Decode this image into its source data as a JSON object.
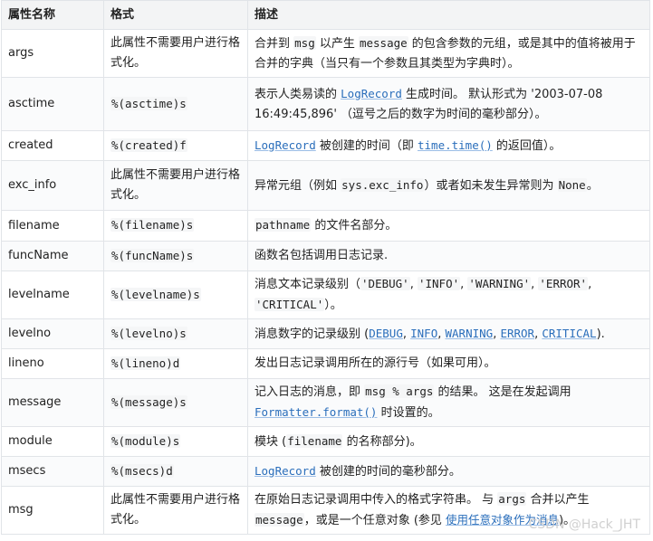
{
  "headers": [
    "属性名称",
    "格式",
    "描述"
  ],
  "rows": [
    {
      "name": "args",
      "format": "此属性不需要用户进行格式化。",
      "desc": [
        {
          "t": "合并到 "
        },
        {
          "c": "msg"
        },
        {
          "t": " 以产生 "
        },
        {
          "c": "message"
        },
        {
          "t": " 的包含参数的元组，或是其中的值将被用于合并的字典（当只有一个参数且其类型为字典时）。"
        }
      ]
    },
    {
      "name": "asctime",
      "format_code": "%(asctime)s",
      "desc": [
        {
          "t": "表示人类易读的 "
        },
        {
          "l": "LogRecord"
        },
        {
          "t": " 生成时间。 默认形式为 '2003-07-08 16:49:45,896' （逗号之后的数字为时间的毫秒部分）。"
        }
      ]
    },
    {
      "name": "created",
      "format_code": "%(created)f",
      "desc": [
        {
          "l": "LogRecord"
        },
        {
          "t": " 被创建的时间（即 "
        },
        {
          "l": "time.time()"
        },
        {
          "t": " 的返回值）。"
        }
      ]
    },
    {
      "name": "exc_info",
      "format": "此属性不需要用户进行格式化。",
      "desc": [
        {
          "t": "异常元组（例如 "
        },
        {
          "c": "sys.exc_info"
        },
        {
          "t": "）或者如未发生异常则为 "
        },
        {
          "c": "None"
        },
        {
          "t": "。"
        }
      ]
    },
    {
      "name": "filename",
      "format_code": "%(filename)s",
      "desc": [
        {
          "c": "pathname"
        },
        {
          "t": " 的文件名部分。"
        }
      ]
    },
    {
      "name": "funcName",
      "format_code": "%(funcName)s",
      "desc": [
        {
          "t": "函数名包括调用日志记录."
        }
      ]
    },
    {
      "name": "levelname",
      "format_code": "%(levelname)s",
      "desc": [
        {
          "t": "消息文本记录级别（"
        },
        {
          "c": "'DEBUG'"
        },
        {
          "t": ", "
        },
        {
          "c": "'INFO'"
        },
        {
          "t": ", "
        },
        {
          "c": "'WARNING'"
        },
        {
          "t": ", "
        },
        {
          "c": "'ERROR'"
        },
        {
          "t": ", "
        },
        {
          "c": "'CRITICAL'"
        },
        {
          "t": "）。"
        }
      ]
    },
    {
      "name": "levelno",
      "format_code": "%(levelno)s",
      "desc": [
        {
          "t": "消息数字的记录级别 ("
        },
        {
          "l": "DEBUG"
        },
        {
          "t": ", "
        },
        {
          "l": "INFO"
        },
        {
          "t": ", "
        },
        {
          "l": "WARNING"
        },
        {
          "t": ", "
        },
        {
          "l": "ERROR"
        },
        {
          "t": ", "
        },
        {
          "l": "CRITICAL"
        },
        {
          "t": ")."
        }
      ]
    },
    {
      "name": "lineno",
      "format_code": "%(lineno)d",
      "desc": [
        {
          "t": "发出日志记录调用所在的源行号（如果可用）。"
        }
      ]
    },
    {
      "name": "message",
      "format_code": "%(message)s",
      "desc": [
        {
          "t": "记入日志的消息，即 "
        },
        {
          "c": "msg % args"
        },
        {
          "t": " 的结果。 这是在发起调用 "
        },
        {
          "l": "Formatter.format()"
        },
        {
          "t": " 时设置的。"
        }
      ]
    },
    {
      "name": "module",
      "format_code": "%(module)s",
      "desc": [
        {
          "t": "模块 ("
        },
        {
          "c": "filename"
        },
        {
          "t": " 的名称部分)。"
        }
      ]
    },
    {
      "name": "msecs",
      "format_code": "%(msecs)d",
      "desc": [
        {
          "l": "LogRecord"
        },
        {
          "t": " 被创建的时间的毫秒部分。"
        }
      ]
    },
    {
      "name": "msg",
      "format": "此属性不需要用户进行格式化。",
      "desc": [
        {
          "t": "在原始日志记录调用中传入的格式字符串。 与 "
        },
        {
          "c": "args"
        },
        {
          "t": " 合并以产生 "
        },
        {
          "c": "message"
        },
        {
          "t": "，或是一个任意对象 (参见 "
        },
        {
          "l": "使用任意对象作为消息"
        },
        {
          "t": ")。"
        }
      ]
    }
  ],
  "watermark": "CSDN @Hack_JHT"
}
